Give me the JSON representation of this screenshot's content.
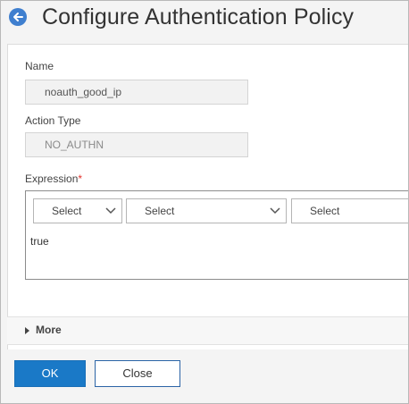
{
  "header": {
    "title": "Configure Authentication Policy"
  },
  "form": {
    "name": {
      "label": "Name",
      "value": "noauth_good_ip"
    },
    "action_type": {
      "label": "Action Type",
      "value": "NO_AUTHN"
    },
    "expression": {
      "label": "Expression",
      "required_marker": "*",
      "selects": [
        "Select",
        "Select",
        "Select"
      ],
      "value": "true"
    }
  },
  "more": {
    "label": "More"
  },
  "footer": {
    "ok_label": "OK",
    "close_label": "Close"
  },
  "colors": {
    "accent": "#1a79c7",
    "back_icon": "#3f7fcf",
    "required": "#e3322c"
  },
  "icons": {
    "back": "arrow-left-circle-icon",
    "chevron": "chevron-down-icon",
    "more": "caret-right-icon"
  }
}
